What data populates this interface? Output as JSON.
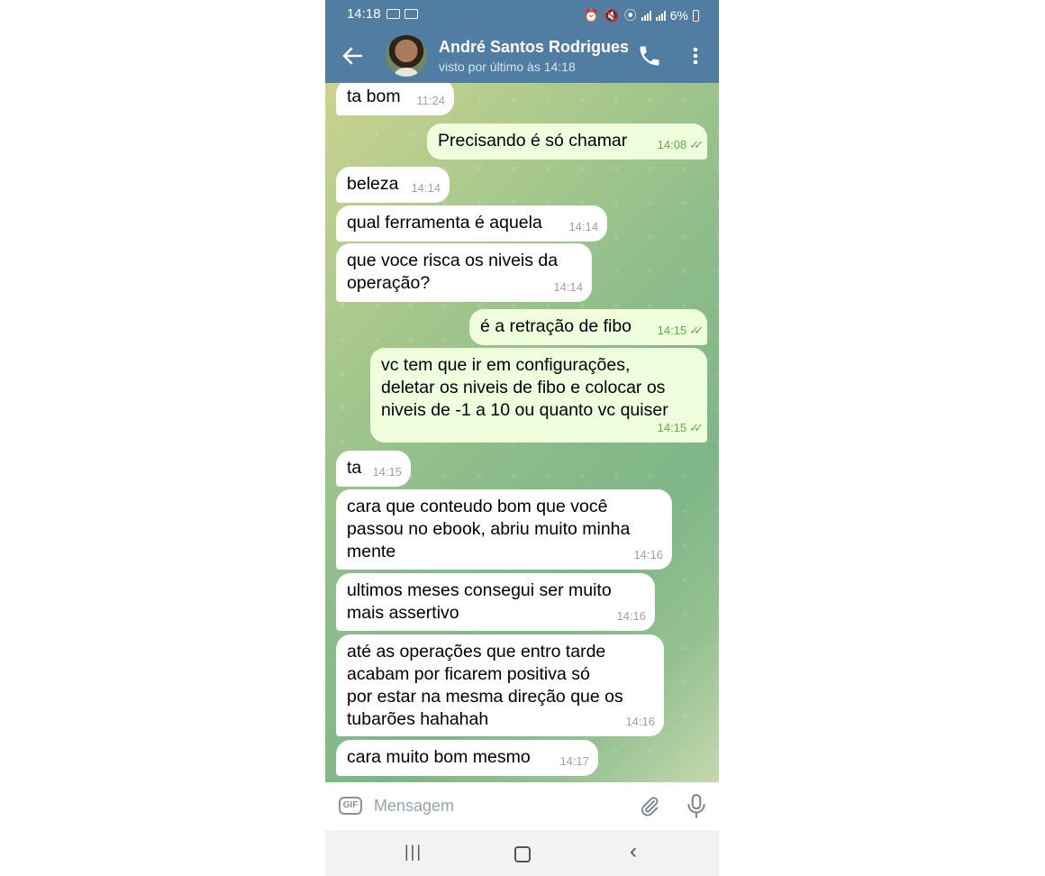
{
  "status_bar": {
    "time": "14:18",
    "battery": "6%",
    "icons": [
      "gallery-icon",
      "gallery-icon",
      "alarm-icon",
      "mute-icon",
      "location-icon",
      "wifi-icon",
      "signal-icon",
      "volte-icon",
      "signal-icon",
      "battery-icon"
    ]
  },
  "header": {
    "contact_name": "André Santos Rodrigues",
    "last_seen": "visto por último às 14:18",
    "back_icon": "arrow-left-icon",
    "call_icon": "phone-icon",
    "menu_icon": "more-vertical-icon"
  },
  "messages": [
    {
      "dir": "in",
      "text": "ta bom",
      "time": "11:24"
    },
    {
      "dir": "out",
      "text": "Precisando é só chamar",
      "time": "14:08",
      "read": true
    },
    {
      "dir": "in",
      "text": "beleza",
      "time": "14:14"
    },
    {
      "dir": "in",
      "text": "qual ferramenta é aquela",
      "time": "14:14"
    },
    {
      "dir": "in",
      "text": "que voce risca os niveis da\noperação?",
      "time": "14:14"
    },
    {
      "dir": "out",
      "text": "é a retração de fibo",
      "time": "14:15",
      "read": true
    },
    {
      "dir": "out",
      "text": "vc tem que ir em configurações,\ndeletar os niveis de fibo e colocar os\nniveis de -1 a 10 ou quanto vc quiser",
      "time": "14:15",
      "read": true
    },
    {
      "dir": "in",
      "text": "ta",
      "time": "14:15"
    },
    {
      "dir": "in",
      "text": "cara que conteudo bom que você\npassou no ebook, abriu muito minha\nmente",
      "time": "14:16"
    },
    {
      "dir": "in",
      "text": "ultimos meses consegui ser muito\nmais assertivo",
      "time": "14:16"
    },
    {
      "dir": "in",
      "text": "até as operações que entro tarde\nacabam por ficarem positiva só\npor estar na mesma direção que os\ntubarões hahahah",
      "time": "14:16"
    },
    {
      "dir": "in",
      "text": "cara muito bom mesmo",
      "time": "14:17"
    }
  ],
  "input": {
    "gif_label": "GIF",
    "placeholder": "Mensagem",
    "attach_icon": "paperclip-icon",
    "mic_icon": "microphone-icon"
  },
  "colors": {
    "header_bg": "#517da2",
    "outgoing_bubble": "#effedd",
    "incoming_bubble": "#ffffff",
    "read_check": "#5cae4a"
  }
}
